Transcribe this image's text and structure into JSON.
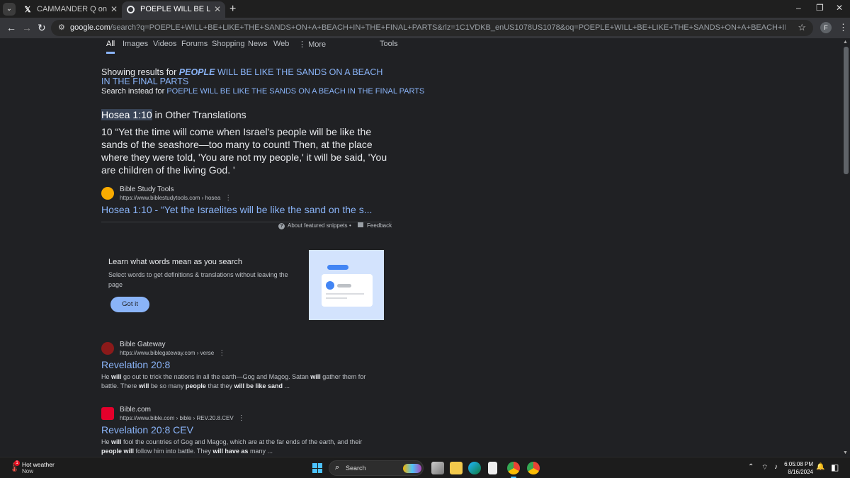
{
  "browser": {
    "tabs": [
      {
        "title": "CAMMANDER Q on X: \"THIS IT",
        "icon": "x-logo-icon",
        "active": false
      },
      {
        "title": "POEPLE WILL BE LIKE THE SANDS",
        "icon": "google-icon",
        "active": true
      }
    ],
    "new_tab": "+",
    "window_controls": [
      "–",
      "❐",
      "✕"
    ],
    "url_domain": "google.com",
    "url_rest": "/search?q=POEPLE+WILL+BE+LIKE+THE+SANDS+ON+A+BEACH+IN+THE+FINAL+PARTS&rlz=1C1VDKB_enUS1078US1078&oq=POEPLE+WILL+BE+LIKE+THE+SANDS+ON+A+BEACH+IN+THE+FINAL+PARTS&gs_lcrp=EgZjaHJvbWUyBggAEEUYOTIKC...",
    "profile_initial": "F"
  },
  "search_tabs": [
    "All",
    "Images",
    "Videos",
    "Forums",
    "Shopping",
    "News",
    "Web",
    "More",
    "Tools"
  ],
  "spelling": {
    "showing_prefix": "Showing results for ",
    "corrected_bold": "PEOPLE",
    "corrected_rest": " WILL BE LIKE THE SANDS ON A BEACH IN THE FINAL PARTS",
    "instead_prefix": "Search instead for ",
    "original_query": "POEPLE WILL BE LIKE THE SANDS ON A BEACH IN THE FINAL PARTS"
  },
  "featured": {
    "ref": "Hosea 1:10",
    "heading_rest": " in Other Translations",
    "body": "10 “Yet the time will come when Israel's people will be like the sands of the seashore—too many to count! Then, at the place where they were told, 'You are not my people,' it will be said, 'You are children of the living God. '",
    "source_name": "Bible Study Tools",
    "source_cite": "https://www.biblestudytools.com › hosea",
    "link_title": "Hosea 1:10 - “Yet the Israelites will be like the sand on the s...",
    "about_label": "About featured snippets",
    "separator": "•",
    "feedback_label": "Feedback"
  },
  "promo": {
    "title": "Learn what words mean as you search",
    "body": "Select words to get definitions & translations without leaving the page",
    "button": "Got it"
  },
  "results": [
    {
      "source_name": "Bible Gateway",
      "source_cite": "https://www.biblegateway.com › verse",
      "title": "Revelation 20:8",
      "snippet_html": "He <b>will</b> go out to trick the nations in all the earth—Gog and Magog. Satan <b>will</b> gather them for battle. There <b>will</b> be so many <b>people</b> that they <b>will be like sand</b> ..."
    },
    {
      "source_name": "Bible.com",
      "source_cite": "https://www.bible.com › bible › REV.20.8.CEV",
      "title": "Revelation 20:8 CEV",
      "snippet_html": "He <b>will</b> fool the countries of Gog and Magog, which are at the far ends of the earth, and their <b>people will</b> follow him into battle. They <b>will have as</b> many ..."
    }
  ],
  "taskbar": {
    "weather_title": "Hot weather",
    "weather_sub": "Now",
    "weather_badge": "1",
    "search_label": "Search",
    "time": "6:05:08 PM",
    "date": "8/16/2024"
  },
  "colors": {
    "link": "#8ab4f8",
    "page_bg": "#202124",
    "accent": "#4cc2ff"
  }
}
